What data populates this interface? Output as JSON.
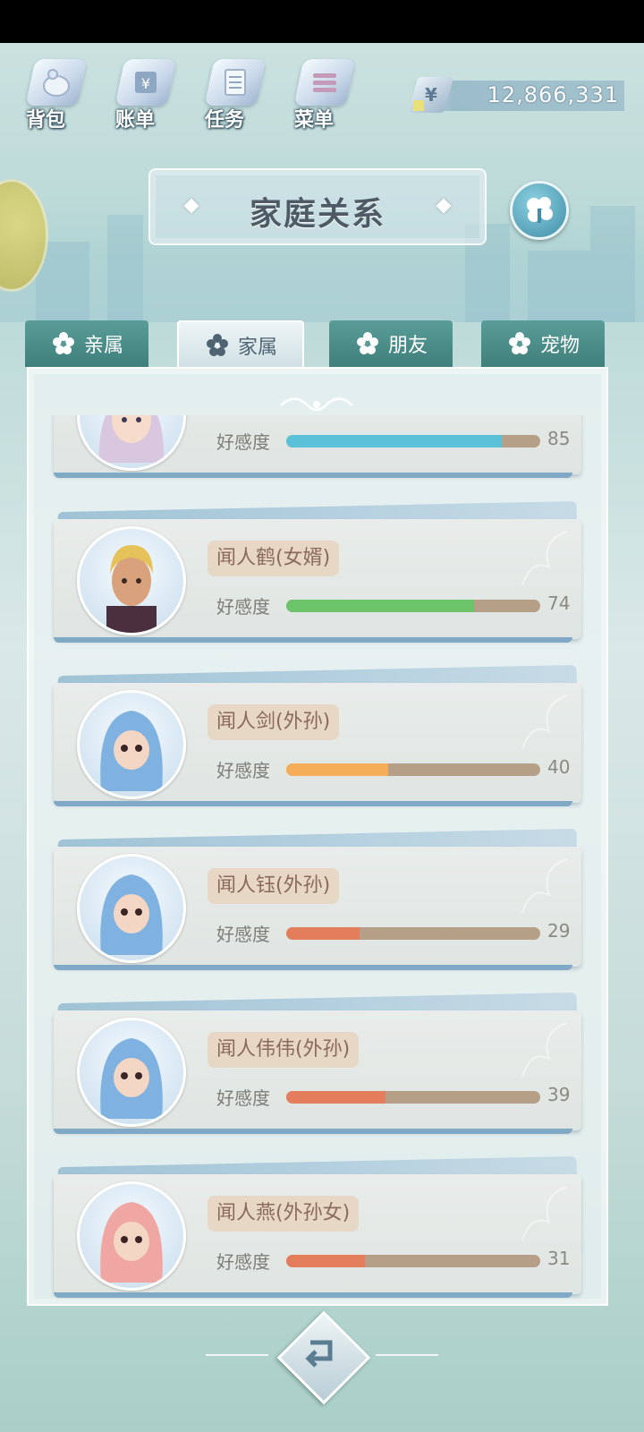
{
  "menu": [
    {
      "label": "背包",
      "icon": "backpack-icon"
    },
    {
      "label": "账单",
      "icon": "bill-icon"
    },
    {
      "label": "任务",
      "icon": "task-icon"
    },
    {
      "label": "菜单",
      "icon": "menu-icon"
    }
  ],
  "money": {
    "symbol": "¥",
    "value": "12,866,331"
  },
  "title": "家庭关系",
  "tabs": [
    {
      "label": "亲属",
      "active": false
    },
    {
      "label": "家属",
      "active": true
    },
    {
      "label": "朋友",
      "active": false
    },
    {
      "label": "宠物",
      "active": false
    }
  ],
  "affection_label": "好感度",
  "members": [
    {
      "name": "",
      "affection": 85,
      "bar_color": "#5bc1d8",
      "avatar": "female-lavender-hair-avatar"
    },
    {
      "name": "闻人鹤(女婿)",
      "affection": 74,
      "bar_color": "#6cc46a",
      "avatar": "blond-man-avatar"
    },
    {
      "name": "闻人剑(外孙)",
      "affection": 40,
      "bar_color": "#f5ad58",
      "avatar": "blue-hood-baby-avatar"
    },
    {
      "name": "闻人钰(外孙)",
      "affection": 29,
      "bar_color": "#e47d5c",
      "avatar": "blue-hood-baby-avatar"
    },
    {
      "name": "闻人伟伟(外孙)",
      "affection": 39,
      "bar_color": "#e47d5c",
      "avatar": "blue-hood-baby-avatar"
    },
    {
      "name": "闻人燕(外孙女)",
      "affection": 31,
      "bar_color": "#e47d5c",
      "avatar": "pink-hood-baby-avatar"
    }
  ]
}
